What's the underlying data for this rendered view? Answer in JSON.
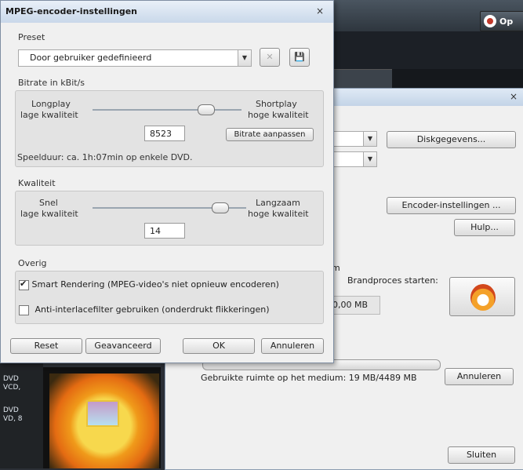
{
  "background_app": {
    "options_button": "Op"
  },
  "burn_dialog": {
    "close": "×",
    "disk_info_button": "Diskgegevens...",
    "encoder_settings_button": "Encoder-instellingen ...",
    "help_button": "Hulp...",
    "truncated_label": "m",
    "burn_start_label": "Brandproces starten:",
    "size_value": "0,00 MB",
    "space_used_text": "Gebruikte ruimte op het medium: 19 MB/4489 MB",
    "cancel_button": "Annuleren",
    "close_button": "Sluiten"
  },
  "left_panel": {
    "items": [
      "DVD",
      "VCD,",
      "DVD",
      "VD, 8"
    ]
  },
  "mpeg_dialog": {
    "title": "MPEG-encoder-instellingen",
    "close": "×",
    "preset": {
      "label": "Preset",
      "selected": "Door gebruiker gedefinieerd"
    },
    "bitrate": {
      "label": "Bitrate in kBit/s",
      "left_top": "Longplay",
      "left_bottom": "lage kwaliteit",
      "right_top": "Shortplay",
      "right_bottom": "hoge kwaliteit",
      "value": "8523",
      "adjust_button": "Bitrate aanpassen",
      "duration_text": "Speelduur: ca. 1h:07min op enkele DVD."
    },
    "quality": {
      "label": "Kwaliteit",
      "left_top": "Snel",
      "left_bottom": "lage kwaliteit",
      "right_top": "Langzaam",
      "right_bottom": "hoge kwaliteit",
      "value": "14"
    },
    "other": {
      "label": "Overig",
      "smart_rendering": "Smart Rendering (MPEG-video's niet opnieuw encoderen)",
      "smart_rendering_checked": true,
      "anti_interlace": "Anti-interlacefilter gebruiken (onderdrukt flikkeringen)",
      "anti_interlace_checked": false
    },
    "buttons": {
      "reset": "Reset",
      "advanced": "Geavanceerd",
      "ok": "OK",
      "cancel": "Annuleren"
    }
  }
}
